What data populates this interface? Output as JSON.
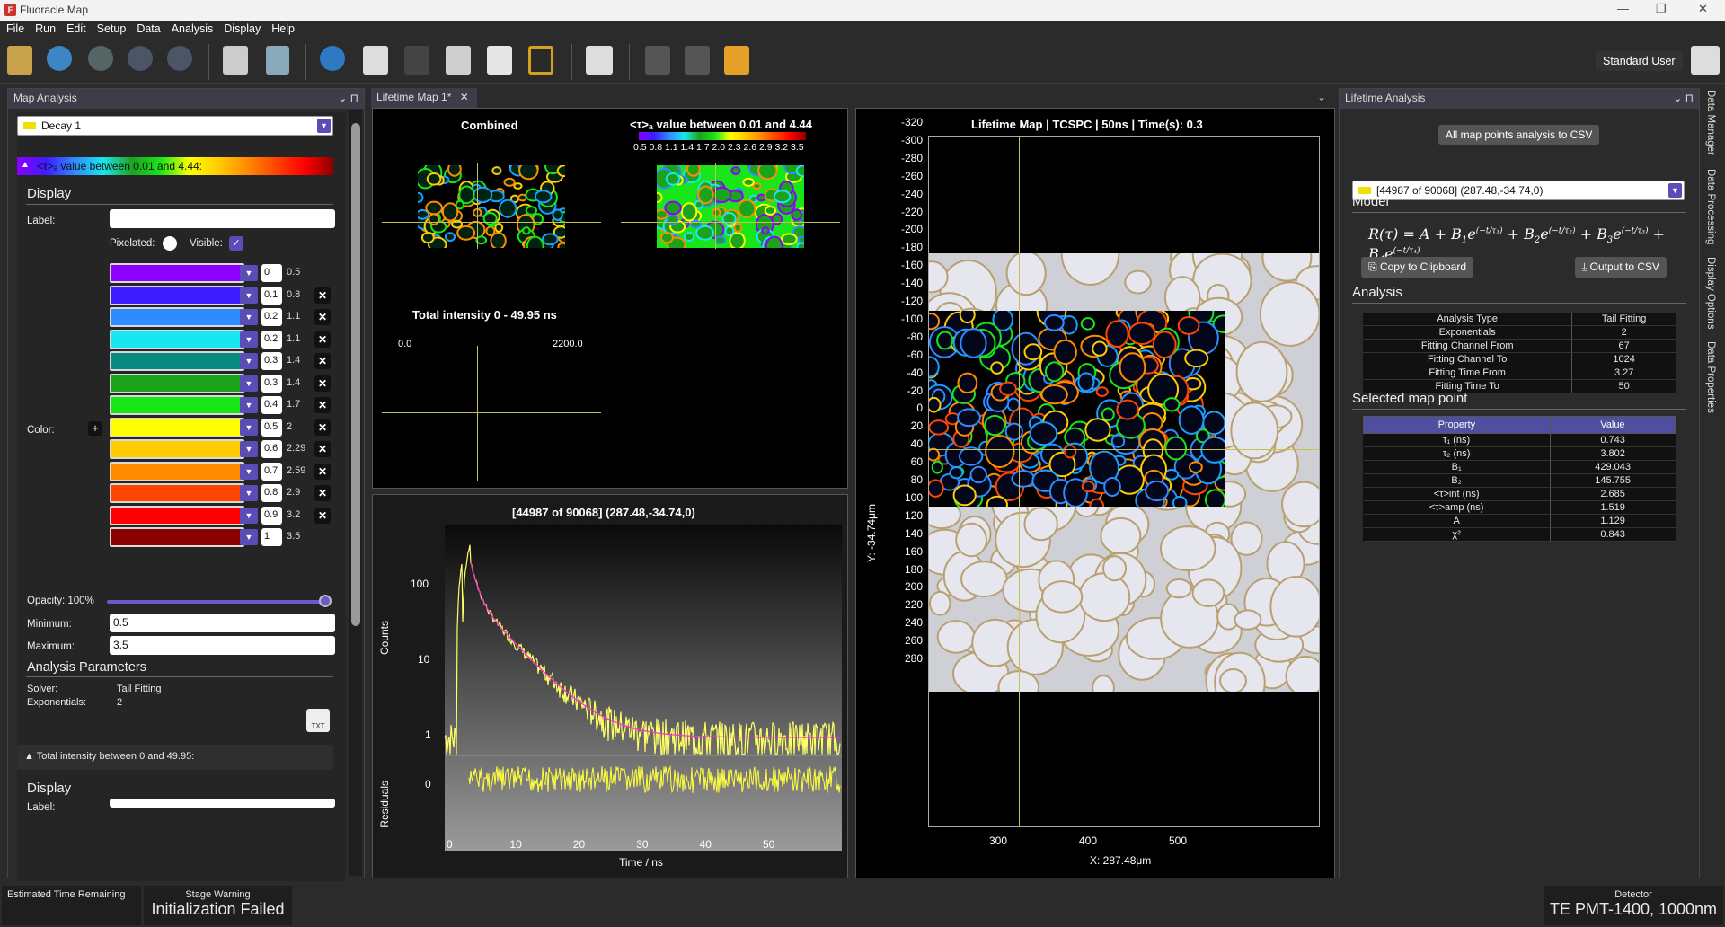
{
  "window": {
    "title": "Fluoracle Map"
  },
  "menu": [
    "File",
    "Run",
    "Edit",
    "Setup",
    "Data",
    "Analysis",
    "Display",
    "Help"
  ],
  "user": {
    "label": "Standard User"
  },
  "left_panel": {
    "title": "Map Analysis",
    "decay_select": "Decay 1",
    "legend_bar": "<τ>ₐ value between 0.01 and 4.44:",
    "display_head": "Display",
    "label_lbl": "Label:",
    "pixelated_lbl": "Pixelated:",
    "visible_lbl": "Visible:",
    "color_lbl": "Color:",
    "colors": [
      {
        "color": "#8b00ff",
        "from": "0",
        "to": "0.5"
      },
      {
        "color": "#3d1cff",
        "from": "0.1",
        "to": "0.8"
      },
      {
        "color": "#2f8bff",
        "from": "0.2",
        "to": "1.1"
      },
      {
        "color": "#19e6f0",
        "from": "0.2",
        "to": "1.1"
      },
      {
        "color": "#088a80",
        "from": "0.3",
        "to": "1.4"
      },
      {
        "color": "#1ca31c",
        "from": "0.3",
        "to": "1.4"
      },
      {
        "color": "#19e619",
        "from": "0.4",
        "to": "1.7"
      },
      {
        "color": "#ffff00",
        "from": "0.5",
        "to": "2"
      },
      {
        "color": "#ffcc00",
        "from": "0.6",
        "to": "2.29"
      },
      {
        "color": "#ff8c00",
        "from": "0.7",
        "to": "2.59"
      },
      {
        "color": "#ff4500",
        "from": "0.8",
        "to": "2.9"
      },
      {
        "color": "#ff0000",
        "from": "0.9",
        "to": "3.2"
      },
      {
        "color": "#8b0000",
        "from": "1",
        "to": "3.5"
      }
    ],
    "opacity_lbl": "Opacity: 100%",
    "opacity": 1.0,
    "minimum_lbl": "Minimum:",
    "minimum": "0.5",
    "maximum_lbl": "Maximum:",
    "maximum": "3.5",
    "analysis_head": "Analysis Parameters",
    "solver_lbl": "Solver:",
    "solver": "Tail Fitting",
    "exp_lbl": "Exponentials:",
    "exp": "2",
    "txt_icon": "TXT",
    "section2": "Total intensity between 0 and 49.95:",
    "display2": "Display",
    "label2": "Label:"
  },
  "center_tab": {
    "label": "Lifetime Map 1*"
  },
  "thumbs": {
    "combined": "Combined",
    "lifetime_title": "<τ>ₐ value between 0.01 and 4.44",
    "lifetime_ticks": [
      "0.5",
      "0.8",
      "1.1",
      "1.4",
      "1.7",
      "2.0",
      "2.3",
      "2.6",
      "2.9",
      "3.2",
      "3.5"
    ],
    "intensity_title": "Total intensity  0 - 49.95 ns",
    "intensity_min": "0.0",
    "intensity_max": "2200.0"
  },
  "decay_plot": {
    "title": "[44987 of 90068] (287.48,-34.74,0)",
    "ylabel": "Counts",
    "ylabel2": "Residuals",
    "xlabel": "Time / ns",
    "yticks": [
      "100",
      "10",
      "1"
    ],
    "resid_tick": "0",
    "xticks": [
      "0",
      "10",
      "20",
      "30",
      "40",
      "50"
    ]
  },
  "map": {
    "title": "Lifetime Map | TCSPC | 50ns | Time(s): 0.3",
    "ylabel": "Y: -34.74μm",
    "xlabel": "X: 287.48μm",
    "yticks": [
      "-320",
      "-300",
      "-280",
      "-260",
      "-240",
      "-220",
      "-200",
      "-180",
      "-160",
      "-140",
      "-120",
      "-100",
      "-80",
      "-60",
      "-40",
      "-20",
      "0",
      "20",
      "40",
      "60",
      "80",
      "100",
      "120",
      "140",
      "160",
      "180",
      "200",
      "220",
      "240",
      "260",
      "280"
    ],
    "xticks": [
      "300",
      "400",
      "500"
    ]
  },
  "right_panel": {
    "title": "Lifetime Analysis",
    "csv_button": "All map points analysis to CSV",
    "point_select": "[44987 of 90068] (287.48,-34.74,0)",
    "model_head": "Model",
    "copy_btn": "Copy to Clipboard",
    "csv_btn": "Output to CSV",
    "analysis_head": "Analysis",
    "analysis_rows": [
      [
        "Analysis Type",
        "Tail Fitting"
      ],
      [
        "Exponentials",
        "2"
      ],
      [
        "Fitting Channel From",
        "67"
      ],
      [
        "Fitting Channel To",
        "1024"
      ],
      [
        "Fitting Time From",
        "3.27"
      ],
      [
        "Fitting Time To",
        "50"
      ]
    ],
    "selected_head": "Selected map point",
    "sel_header": [
      "Property",
      "Value"
    ],
    "sel_rows": [
      [
        "τ₁ (ns)",
        "0.743"
      ],
      [
        "τ₂ (ns)",
        "3.802"
      ],
      [
        "B₁",
        "429.043"
      ],
      [
        "B₂",
        "145.755"
      ],
      [
        "<τ>int (ns)",
        "2.685"
      ],
      [
        "<τ>amp (ns)",
        "1.519"
      ],
      [
        "A",
        "1.129"
      ],
      [
        "χ²",
        "0.843"
      ]
    ]
  },
  "side_tabs": [
    "Data Manager",
    "Data Processing",
    "Display Options",
    "Data Properties"
  ],
  "statusbar": {
    "etr": "Estimated Time Remaining",
    "stage_lbl": "Stage Warning",
    "stage_val": "Initialization Failed",
    "det_lbl": "Detector",
    "det_val": "TE PMT-1400, 1000nm"
  }
}
